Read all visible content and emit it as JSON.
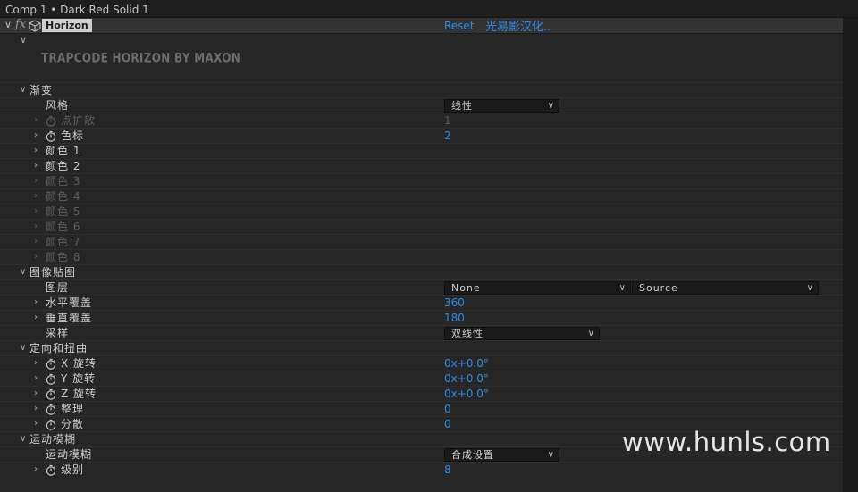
{
  "window": {
    "title": "Comp 1 • Dark Red Solid 1"
  },
  "effect": {
    "fx_label": "fx",
    "name": "Horizon",
    "reset_label": "Reset",
    "credit": "光易影汉化..",
    "logo_text": "TRAPCODE HORIZON BY MAXON"
  },
  "rows": [
    {
      "id": "gradient",
      "label": "渐变",
      "type": "group",
      "expanded": true
    },
    {
      "id": "style",
      "label": "风格",
      "type": "select",
      "value": "线性"
    },
    {
      "id": "point-spread",
      "label": "点扩散",
      "type": "value",
      "value": "1",
      "stopwatch": true,
      "expandable": true,
      "disabled": true
    },
    {
      "id": "color-stops",
      "label": "色标",
      "type": "value",
      "value": "2",
      "stopwatch": true,
      "expandable": true
    },
    {
      "id": "color1",
      "label": "颜色 1",
      "type": "expand"
    },
    {
      "id": "color2",
      "label": "颜色 2",
      "type": "expand"
    },
    {
      "id": "color3",
      "label": "颜色 3",
      "type": "expand",
      "disabled": true
    },
    {
      "id": "color4",
      "label": "颜色 4",
      "type": "expand",
      "disabled": true
    },
    {
      "id": "color5",
      "label": "颜色 5",
      "type": "expand",
      "disabled": true
    },
    {
      "id": "color6",
      "label": "颜色 6",
      "type": "expand",
      "disabled": true
    },
    {
      "id": "color7",
      "label": "颜色 7",
      "type": "expand",
      "disabled": true
    },
    {
      "id": "color8",
      "label": "颜色 8",
      "type": "expand",
      "disabled": true
    },
    {
      "id": "image-map",
      "label": "图像贴图",
      "type": "group",
      "expanded": true
    },
    {
      "id": "layer",
      "label": "图层",
      "type": "dual-select",
      "value": "None",
      "value2": "Source"
    },
    {
      "id": "h-cover",
      "label": "水平覆盖",
      "type": "value",
      "value": "360",
      "expandable": true
    },
    {
      "id": "v-cover",
      "label": "垂直覆盖",
      "type": "value",
      "value": "180",
      "expandable": true
    },
    {
      "id": "sampling",
      "label": "采样",
      "type": "select",
      "value": "双线性"
    },
    {
      "id": "orient",
      "label": "定向和扭曲",
      "type": "group",
      "expanded": true
    },
    {
      "id": "x-rot",
      "label": "X 旋转",
      "type": "value",
      "value": "0x+0.0°",
      "stopwatch": true,
      "expandable": true
    },
    {
      "id": "y-rot",
      "label": "Y 旋转",
      "type": "value",
      "value": "0x+0.0°",
      "stopwatch": true,
      "expandable": true
    },
    {
      "id": "z-rot",
      "label": "Z 旋转",
      "type": "value",
      "value": "0x+0.0°",
      "stopwatch": true,
      "expandable": true
    },
    {
      "id": "tidy",
      "label": "整理",
      "type": "value",
      "value": "0",
      "stopwatch": true,
      "expandable": true
    },
    {
      "id": "scatter",
      "label": "分散",
      "type": "value",
      "value": "0",
      "stopwatch": true,
      "expandable": true
    },
    {
      "id": "motion-blur-group",
      "label": "运动模糊",
      "type": "group",
      "expanded": true
    },
    {
      "id": "motion-blur",
      "label": "运动模糊",
      "type": "select",
      "value": "合成设置"
    },
    {
      "id": "level",
      "label": "级别",
      "type": "value",
      "value": "8",
      "stopwatch": true,
      "expandable": true
    }
  ],
  "watermark": "www.hunls.com",
  "colors": {
    "accent": "#2f8be8",
    "panel": "#262626",
    "header": "#333333"
  }
}
